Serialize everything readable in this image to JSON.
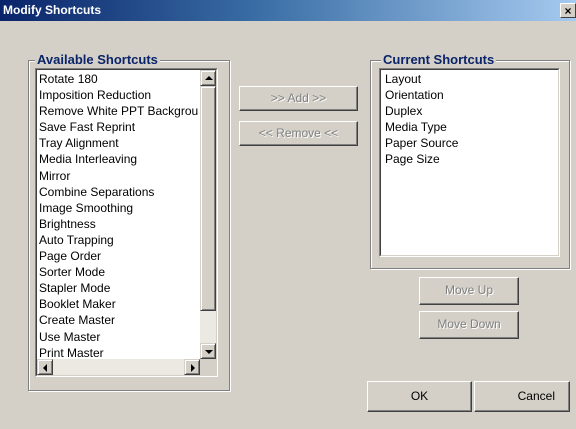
{
  "window": {
    "title": "Modify Shortcuts",
    "close_glyph": "×"
  },
  "available": {
    "label": "Available Shortcuts",
    "items": [
      "Rotate 180",
      "Imposition Reduction",
      "Remove White PPT Background",
      "Save Fast Reprint",
      "Tray Alignment",
      "Media Interleaving",
      "Mirror",
      "Combine Separations",
      "Image Smoothing",
      "Brightness",
      "Auto Trapping",
      "Page Order",
      "Sorter Mode",
      "Stapler Mode",
      "Booklet Maker",
      "Create Master",
      "Use Master",
      "Print Master"
    ]
  },
  "current": {
    "label": "Current Shortcuts",
    "items": [
      "Layout",
      "Orientation",
      "Duplex",
      "Media Type",
      "Paper Source",
      "Page Size"
    ]
  },
  "buttons": {
    "add": ">> Add >>",
    "remove": "<< Remove <<",
    "move_up": "Move Up",
    "move_down": "Move Down",
    "ok": "OK",
    "cancel": "Cancel"
  },
  "icons": {
    "scroll_up": "triangle-up",
    "scroll_down": "triangle-down",
    "scroll_left": "triangle-left",
    "scroll_right": "triangle-right"
  }
}
